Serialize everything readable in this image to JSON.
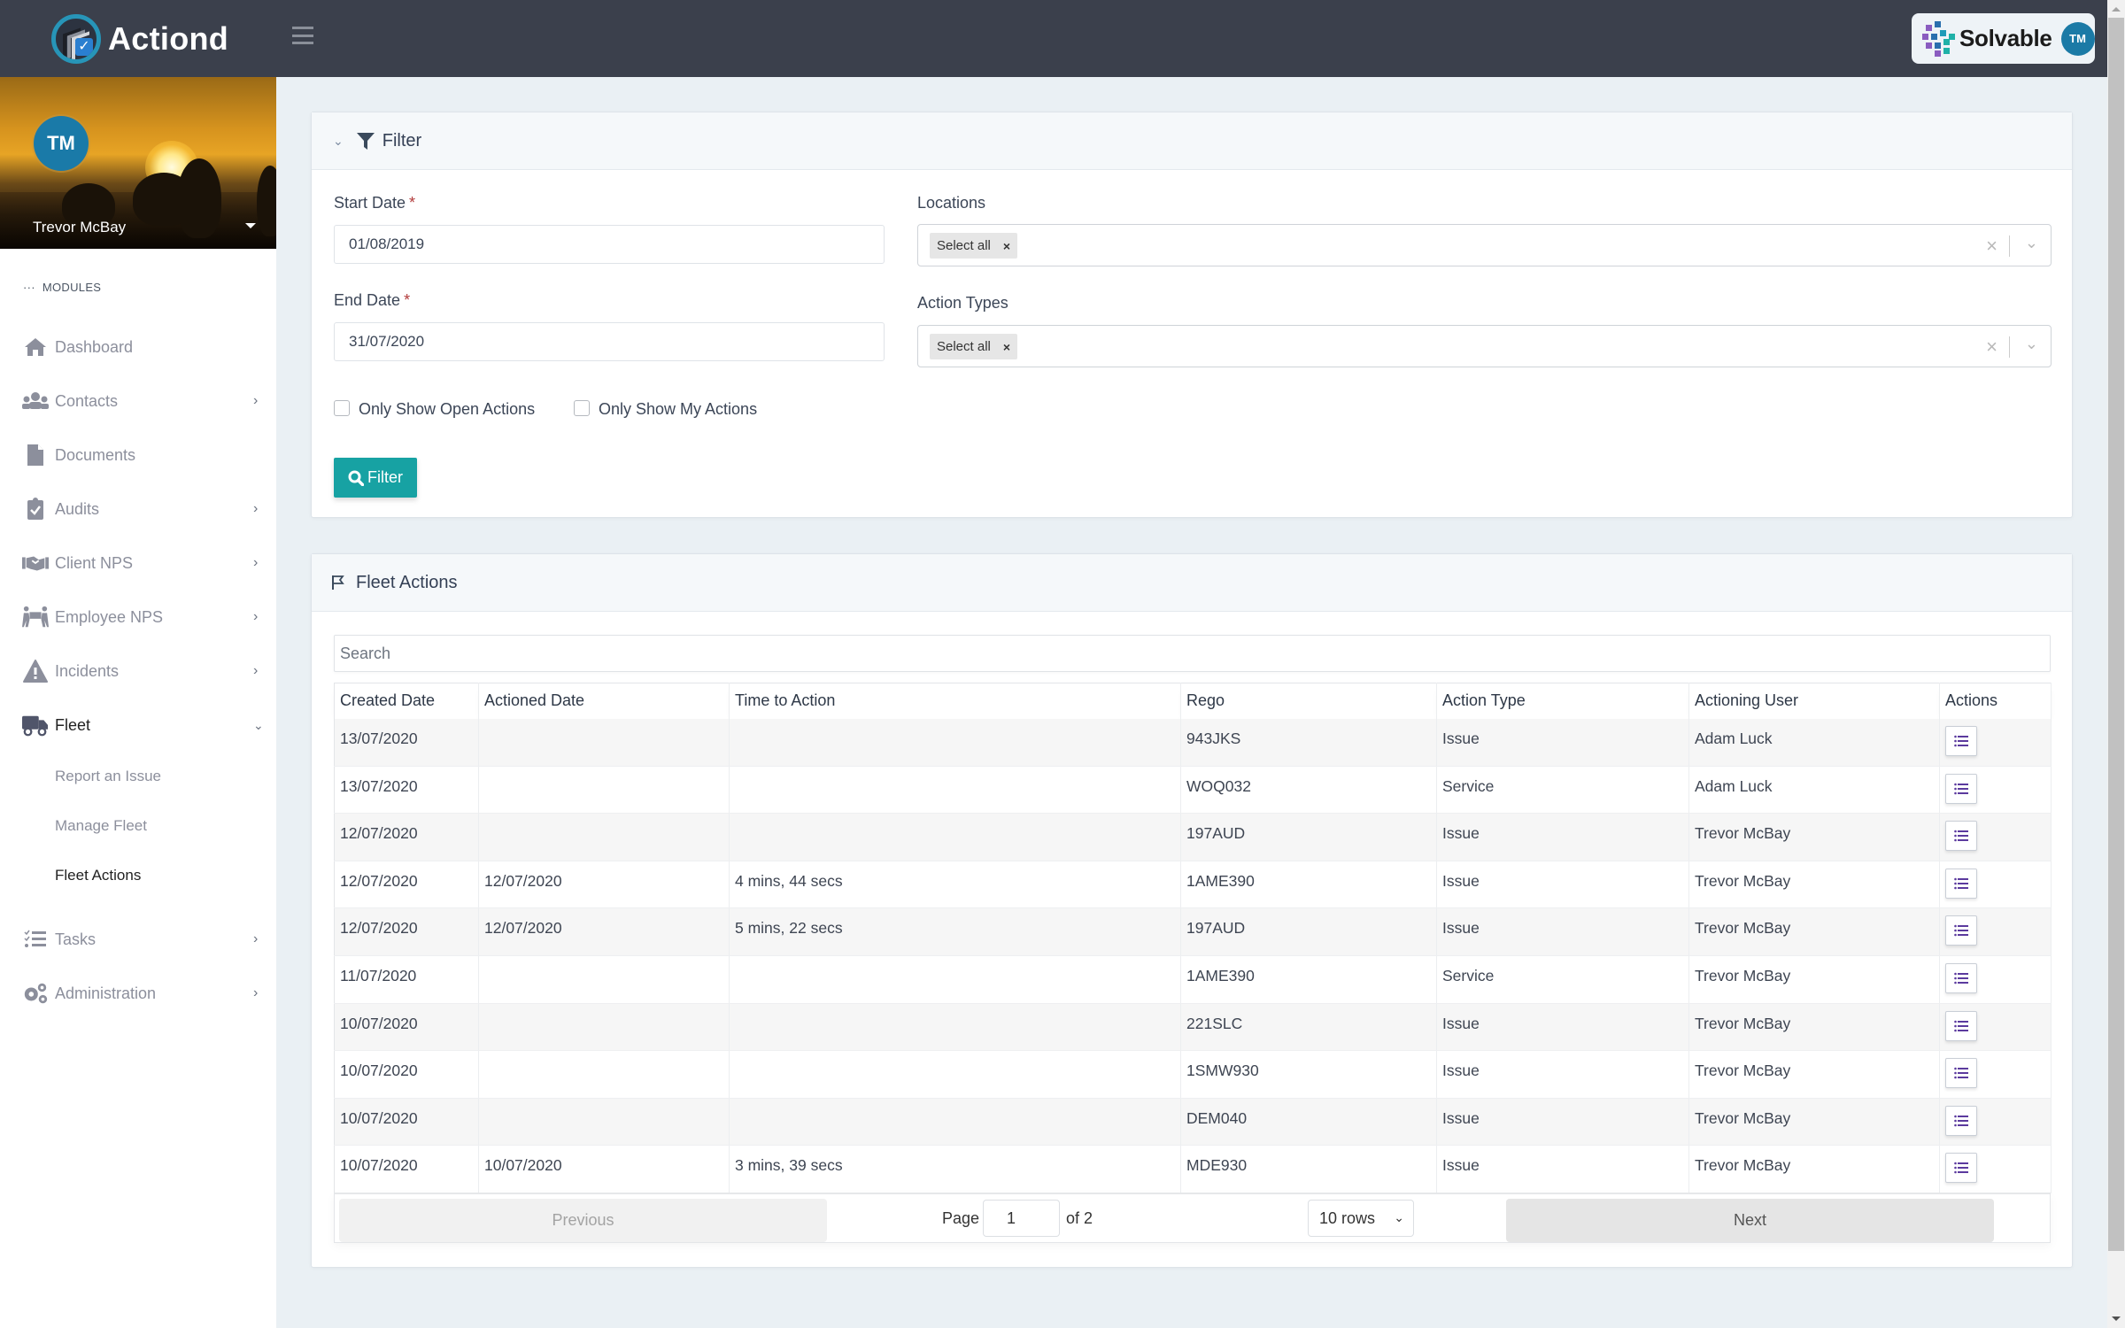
{
  "app": {
    "logo_text": "Actiond",
    "brand_name": "Solvable",
    "brand_avatar_initials": "TM"
  },
  "user": {
    "initials": "TM",
    "name": "Trevor McBay"
  },
  "sidebar": {
    "section_label": "MODULES",
    "items": [
      {
        "label": "Dashboard",
        "icon": "home-icon",
        "has_children": false
      },
      {
        "label": "Contacts",
        "icon": "users-icon",
        "has_children": true
      },
      {
        "label": "Documents",
        "icon": "document-icon",
        "has_children": false
      },
      {
        "label": "Audits",
        "icon": "clipboard-check-icon",
        "has_children": true
      },
      {
        "label": "Client NPS",
        "icon": "handshake-icon",
        "has_children": true
      },
      {
        "label": "Employee NPS",
        "icon": "people-carry-icon",
        "has_children": true
      },
      {
        "label": "Incidents",
        "icon": "warning-icon",
        "has_children": true
      },
      {
        "label": "Fleet",
        "icon": "truck-icon",
        "has_children": true,
        "expanded": true
      },
      {
        "label": "Tasks",
        "icon": "tasks-icon",
        "has_children": true
      },
      {
        "label": "Administration",
        "icon": "gears-icon",
        "has_children": true
      }
    ],
    "fleet_subitems": [
      {
        "label": "Report an Issue",
        "current": false
      },
      {
        "label": "Manage Fleet",
        "current": false
      },
      {
        "label": "Fleet Actions",
        "current": true
      }
    ]
  },
  "filter": {
    "title": "Filter",
    "start_date_label": "Start Date",
    "start_date_value": "01/08/2019",
    "end_date_label": "End Date",
    "end_date_value": "31/07/2020",
    "required_marker": "*",
    "locations_label": "Locations",
    "locations_chip": "Select all",
    "action_types_label": "Action Types",
    "action_types_chip": "Select all",
    "chip_remove": "×",
    "clear_glyph": "×",
    "dropdown_glyph": "⌄",
    "open_actions_label": "Only Show Open Actions",
    "open_actions_checked": false,
    "my_actions_label": "Only Show My Actions",
    "my_actions_checked": false,
    "button_label": "Filter"
  },
  "fleet_actions": {
    "title": "Fleet Actions",
    "search_placeholder": "Search",
    "columns": [
      "Created Date",
      "Actioned Date",
      "Time to Action",
      "Rego",
      "Action Type",
      "Actioning User",
      "Actions"
    ],
    "rows": [
      {
        "created": "13/07/2020",
        "actioned": "",
        "time": "",
        "rego": "943JKS",
        "type": "Issue",
        "user": "Adam Luck"
      },
      {
        "created": "13/07/2020",
        "actioned": "",
        "time": "",
        "rego": "WOQ032",
        "type": "Service",
        "user": "Adam Luck"
      },
      {
        "created": "12/07/2020",
        "actioned": "",
        "time": "",
        "rego": "197AUD",
        "type": "Issue",
        "user": "Trevor McBay"
      },
      {
        "created": "12/07/2020",
        "actioned": "12/07/2020",
        "time": "4 mins, 44 secs",
        "rego": "1AME390",
        "type": "Issue",
        "user": "Trevor McBay"
      },
      {
        "created": "12/07/2020",
        "actioned": "12/07/2020",
        "time": "5 mins, 22 secs",
        "rego": "197AUD",
        "type": "Issue",
        "user": "Trevor McBay"
      },
      {
        "created": "11/07/2020",
        "actioned": "",
        "time": "",
        "rego": "1AME390",
        "type": "Service",
        "user": "Trevor McBay"
      },
      {
        "created": "10/07/2020",
        "actioned": "",
        "time": "",
        "rego": "221SLC",
        "type": "Issue",
        "user": "Trevor McBay"
      },
      {
        "created": "10/07/2020",
        "actioned": "",
        "time": "",
        "rego": "1SMW930",
        "type": "Issue",
        "user": "Trevor McBay"
      },
      {
        "created": "10/07/2020",
        "actioned": "",
        "time": "",
        "rego": "DEM040",
        "type": "Issue",
        "user": "Trevor McBay"
      },
      {
        "created": "10/07/2020",
        "actioned": "10/07/2020",
        "time": "3 mins, 39 secs",
        "rego": "MDE930",
        "type": "Issue",
        "user": "Trevor McBay"
      }
    ],
    "pagination": {
      "previous_label": "Previous",
      "next_label": "Next",
      "page_label": "Page",
      "current_page": "1",
      "of_label": "of 2",
      "rows_option": "10 rows"
    }
  },
  "colors": {
    "header_bg": "#3b404c",
    "accent_teal": "#17a2a3",
    "avatar_blue": "#1a7aa8",
    "action_icon_purple": "#5b3a9e",
    "page_bg": "#eaf0f4"
  }
}
